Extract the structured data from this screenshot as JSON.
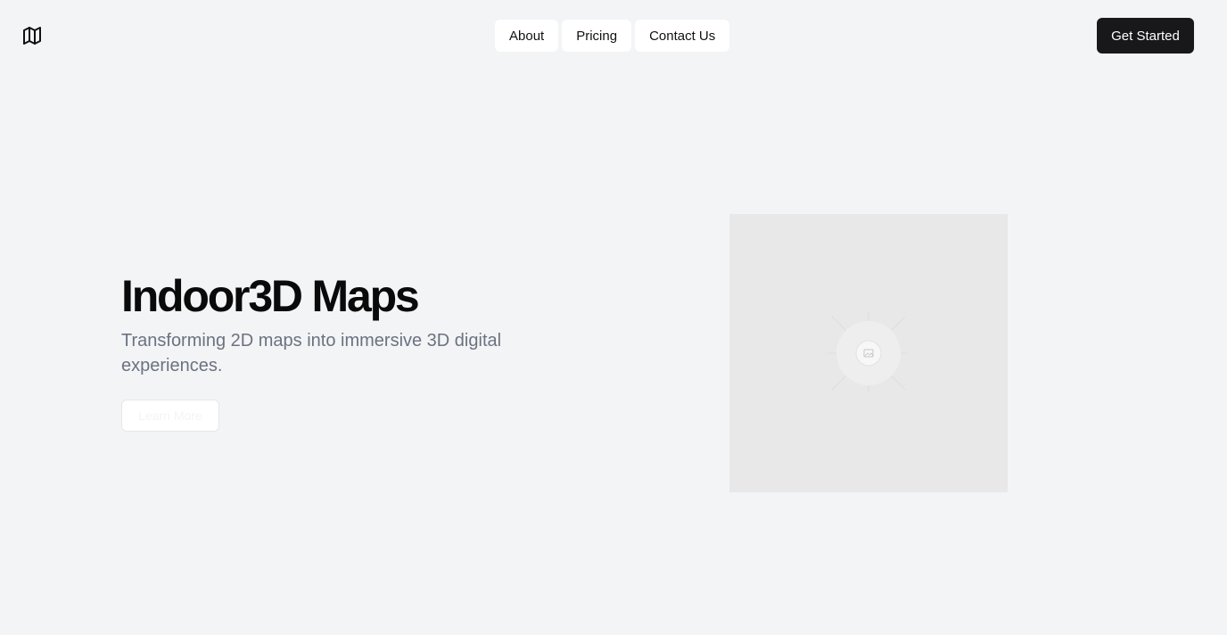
{
  "header": {
    "logo_icon": "map-icon",
    "nav": [
      {
        "label": "About"
      },
      {
        "label": "Pricing"
      },
      {
        "label": "Contact Us"
      }
    ],
    "cta_label": "Get Started"
  },
  "hero": {
    "title": "Indoor3D Maps",
    "subtitle": "Transforming 2D maps into immersive 3D digital experiences.",
    "button_label": "Learn More",
    "image_icon": "image-placeholder-icon"
  },
  "colors": {
    "background": "#f3f4f6",
    "primary_button": "#18181b",
    "subtitle_text": "#6b7280",
    "image_placeholder": "#e8e8e8"
  }
}
